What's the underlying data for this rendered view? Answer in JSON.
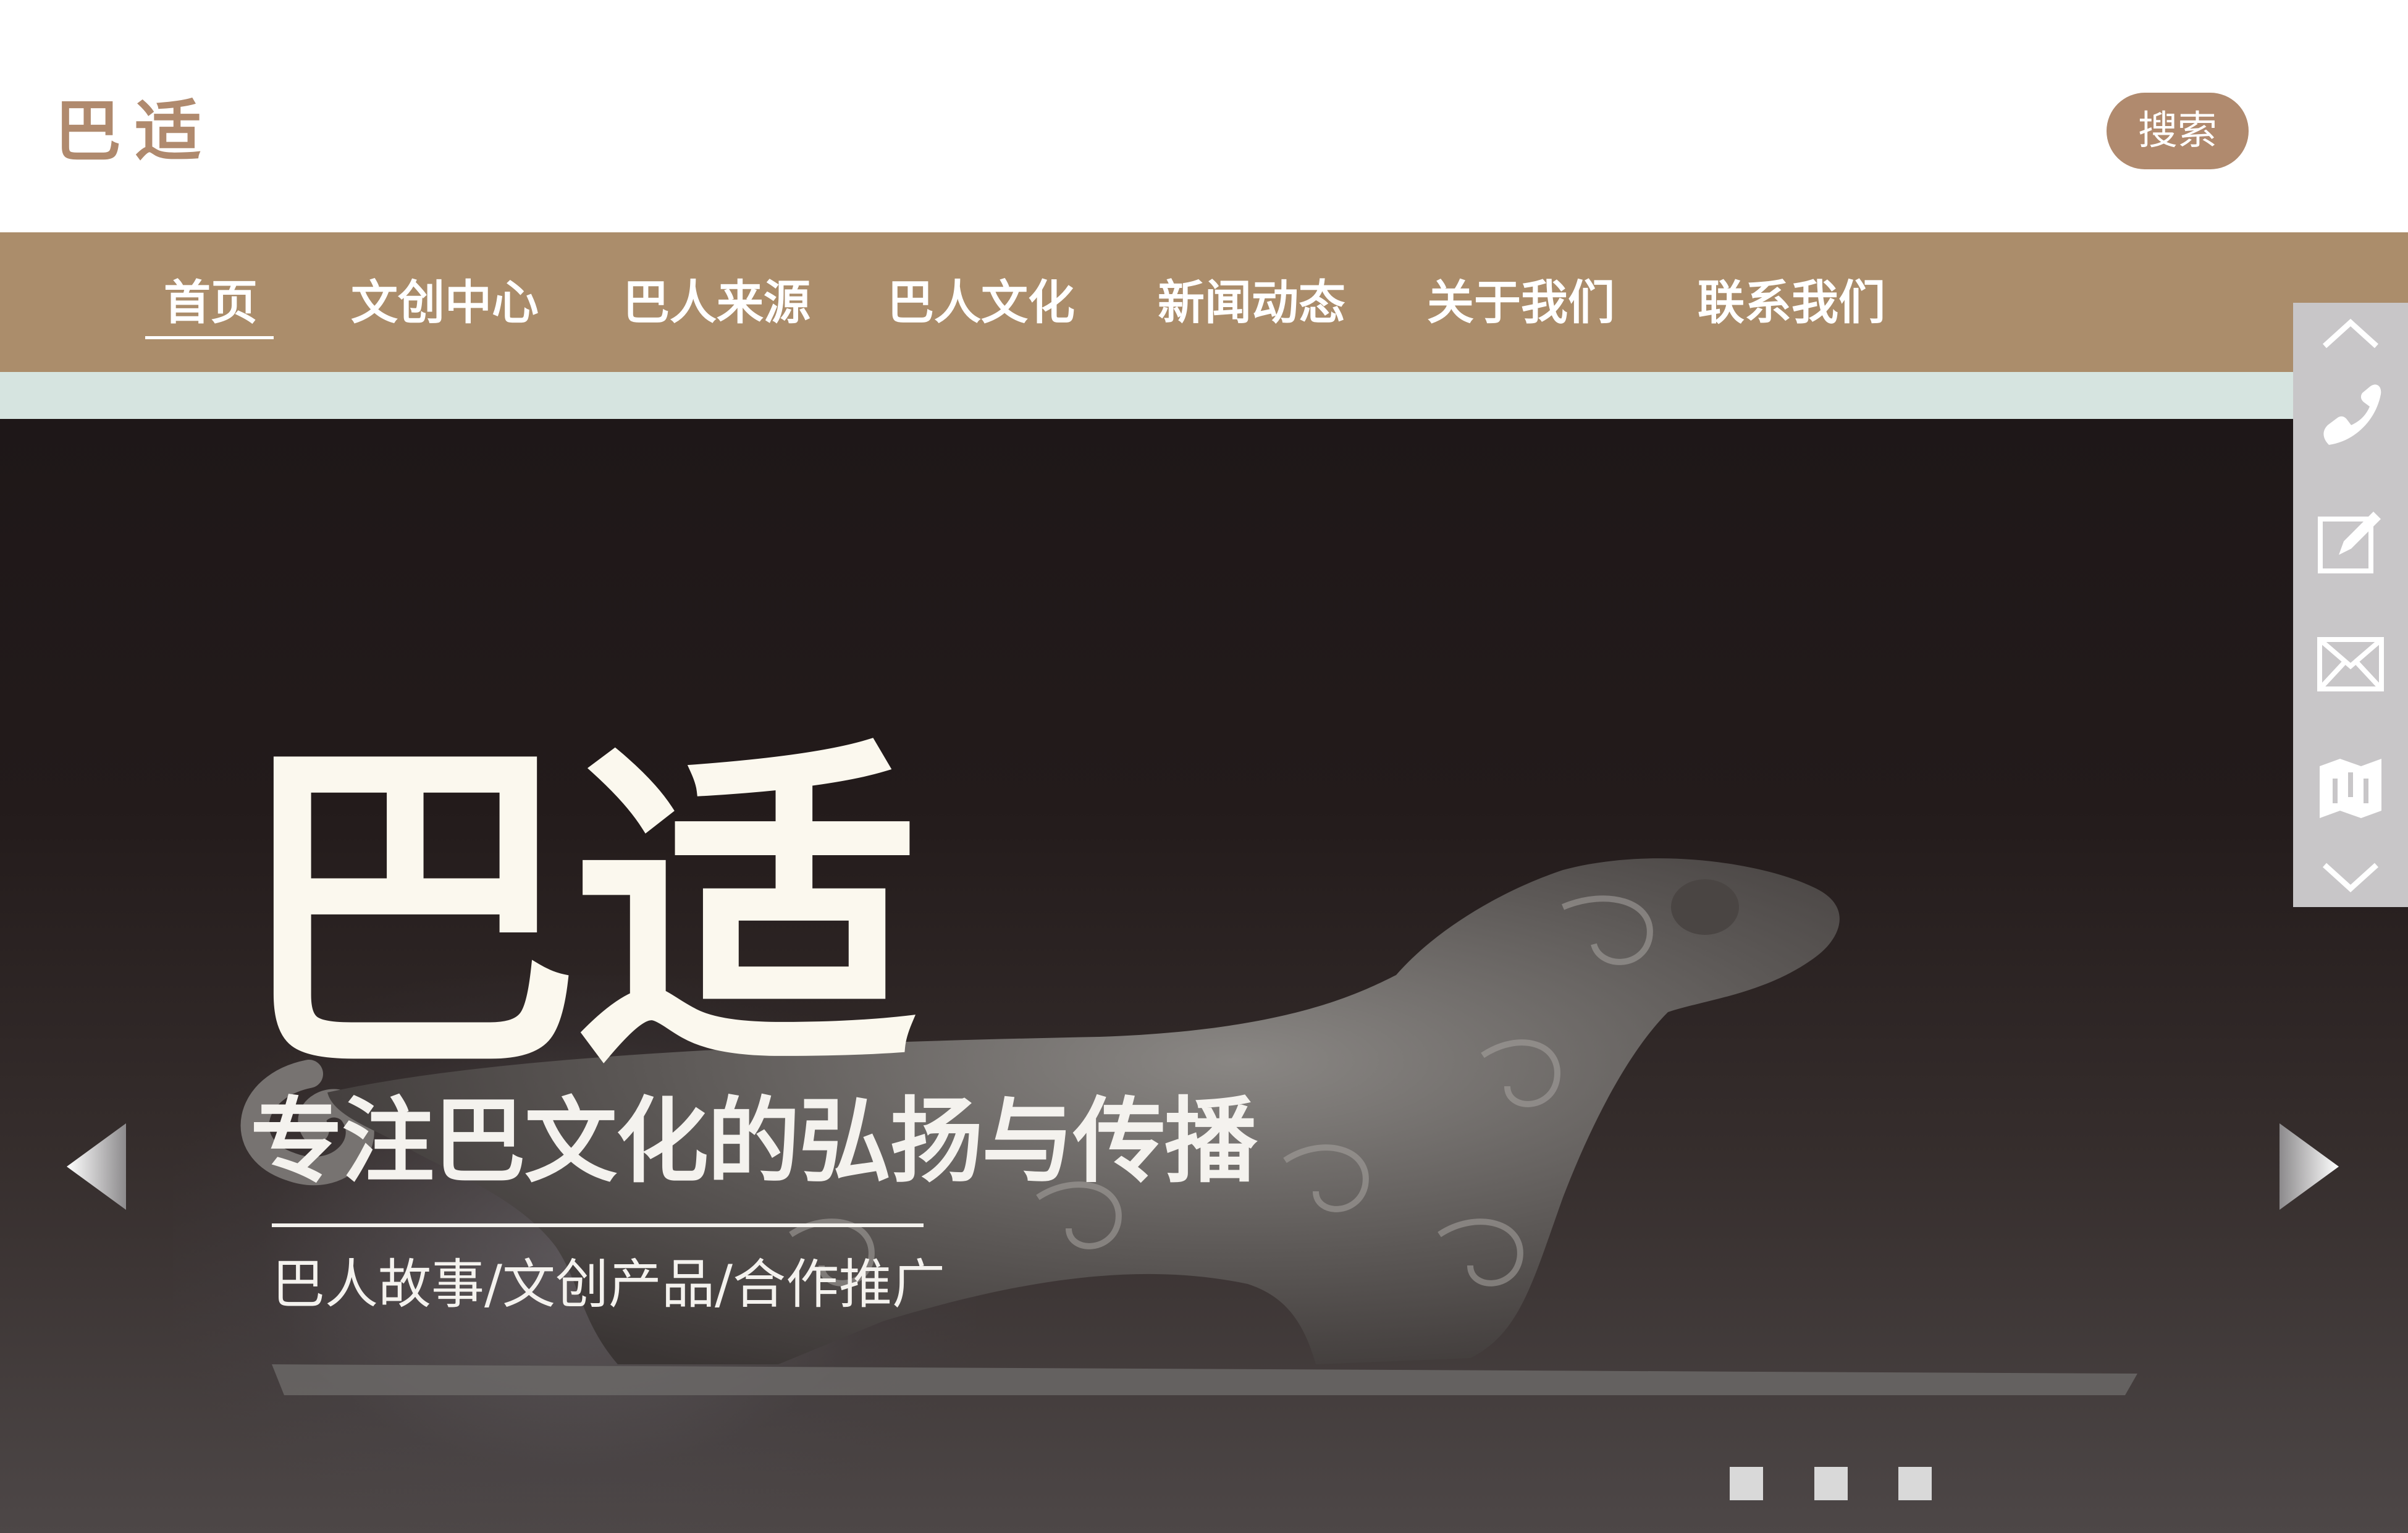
{
  "header": {
    "logo": "巴适",
    "search_label": "搜索"
  },
  "nav": {
    "items": [
      {
        "label": "首页",
        "active": true
      },
      {
        "label": "文创中心"
      },
      {
        "label": "巴人来源"
      },
      {
        "label": "巴人文化"
      },
      {
        "label": "新闻动态"
      },
      {
        "label": "关于我们"
      },
      {
        "label": "联系我们"
      }
    ]
  },
  "hero": {
    "title": "巴适",
    "subtitle": "专注巴文化的弘扬与传播",
    "tags": "巴人故事/文创产品/合作推广",
    "slides": 3
  },
  "side_toolbar": {
    "icons": [
      "chevron-up-icon",
      "phone-icon",
      "edit-icon",
      "mail-icon",
      "map-icon",
      "chevron-down-icon"
    ]
  },
  "colors": {
    "brand": "#b08a6e",
    "nav_bg": "#ab8d6b",
    "mint": "#d6e4e0",
    "side_bar": "#c8c6c8"
  }
}
